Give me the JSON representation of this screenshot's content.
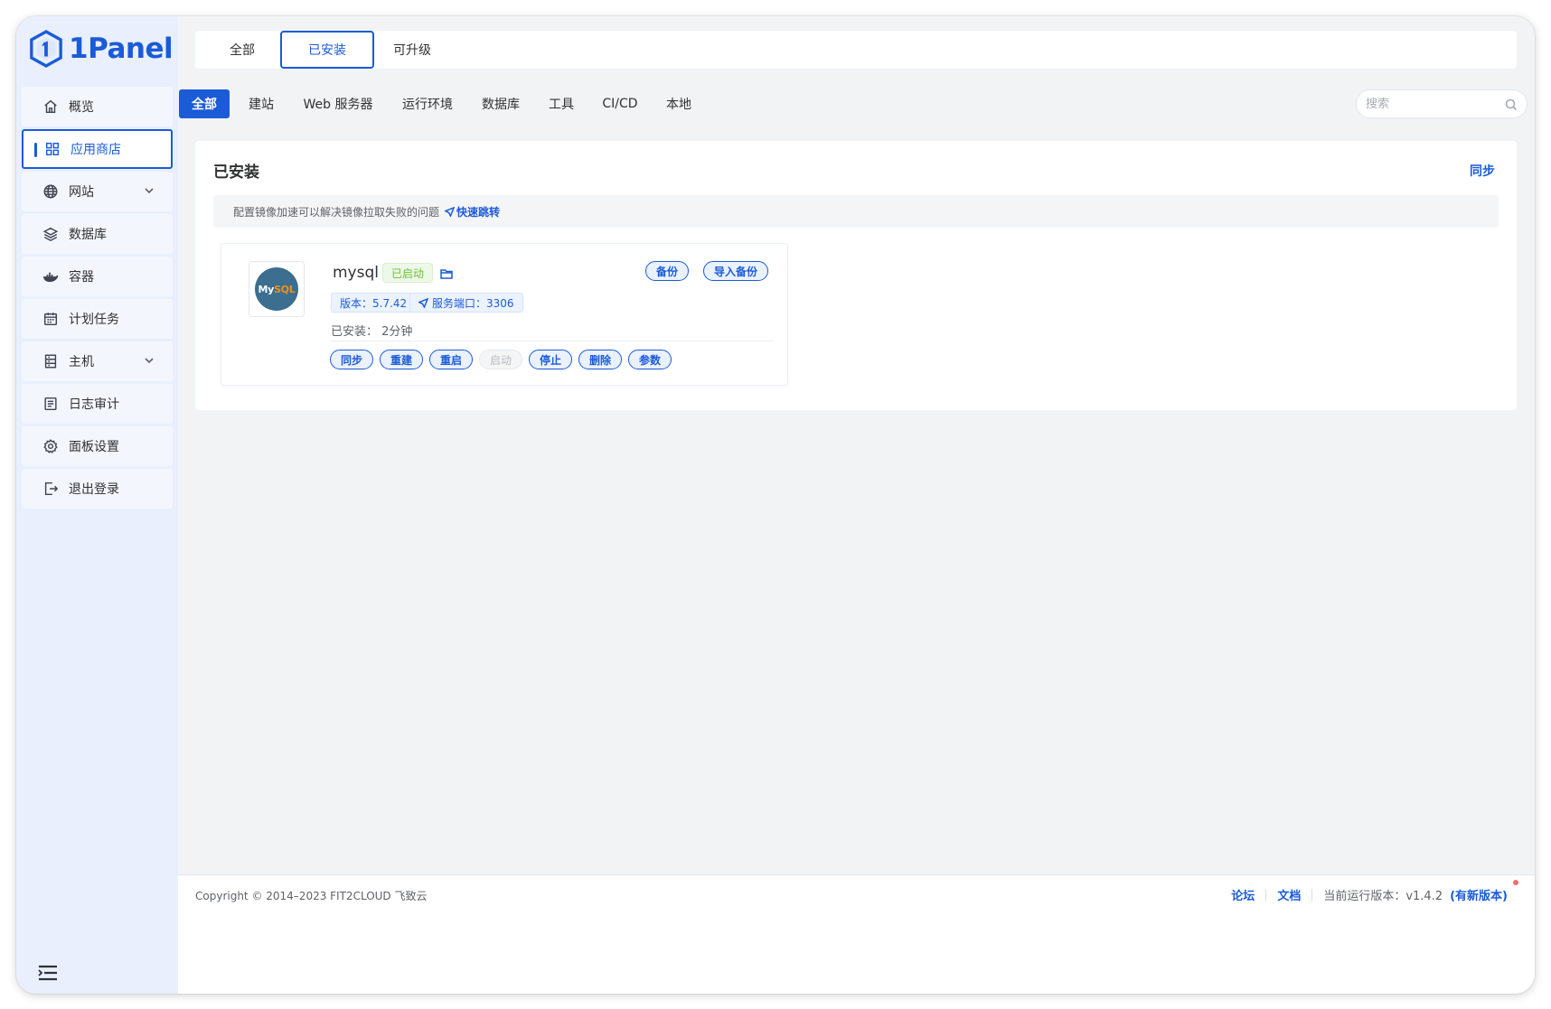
{
  "app": {
    "logo_text": "1Panel"
  },
  "sidebar": {
    "items": [
      {
        "label": "概览",
        "icon": "home-icon"
      },
      {
        "label": "应用商店",
        "icon": "grid-icon"
      },
      {
        "label": "网站",
        "icon": "globe-icon"
      },
      {
        "label": "数据库",
        "icon": "layers-icon"
      },
      {
        "label": "容器",
        "icon": "docker-whale-icon"
      },
      {
        "label": "计划任务",
        "icon": "calendar-icon"
      },
      {
        "label": "主机",
        "icon": "server-icon"
      },
      {
        "label": "日志审计",
        "icon": "document-list-icon"
      },
      {
        "label": "面板设置",
        "icon": "gear-icon"
      },
      {
        "label": "退出登录",
        "icon": "logout-icon"
      }
    ],
    "active_index": 1
  },
  "top_tabs": [
    {
      "label": "全部"
    },
    {
      "label": "已安装"
    },
    {
      "label": "可升级"
    }
  ],
  "category_tabs": [
    {
      "label": "全部"
    },
    {
      "label": "建站"
    },
    {
      "label": "Web 服务器"
    },
    {
      "label": "运行环境"
    },
    {
      "label": "数据库"
    },
    {
      "label": "工具"
    },
    {
      "label": "CI/CD"
    },
    {
      "label": "本地"
    }
  ],
  "search": {
    "placeholder": "搜索",
    "value": ""
  },
  "panel": {
    "title": "已安装",
    "sync_label": "同步",
    "notice_text": "配置镜像加速可以解决镜像拉取失败的问题",
    "notice_link": "快速跳转"
  },
  "app_card": {
    "name": "mysql",
    "logo_text_a": "My",
    "logo_text_b": "SQL",
    "status": "已启动",
    "backup_label": "备份",
    "import_backup_label": "导入备份",
    "version_tag": "版本：5.7.42",
    "port_tag": "服务端口：3306",
    "installed_label": "已安装：",
    "installed_value": "2分钟",
    "actions": [
      {
        "label": "同步",
        "enabled": true
      },
      {
        "label": "重建",
        "enabled": true
      },
      {
        "label": "重启",
        "enabled": true
      },
      {
        "label": "启动",
        "enabled": false
      },
      {
        "label": "停止",
        "enabled": true
      },
      {
        "label": "删除",
        "enabled": true
      },
      {
        "label": "参数",
        "enabled": true
      }
    ]
  },
  "footer": {
    "copyright": "Copyright © 2014–2023 FIT2CLOUD 飞致云",
    "forum": "论坛",
    "docs": "文档",
    "version_label": "当前运行版本：v1.4.2",
    "new_version": "(有新版本)"
  },
  "colors": {
    "accent": "#1b5bd8",
    "success": "#67c23a",
    "sidebar_bg": "#e9effc",
    "content_bg": "#f2f3f5",
    "danger_dot": "#f56c6c"
  }
}
